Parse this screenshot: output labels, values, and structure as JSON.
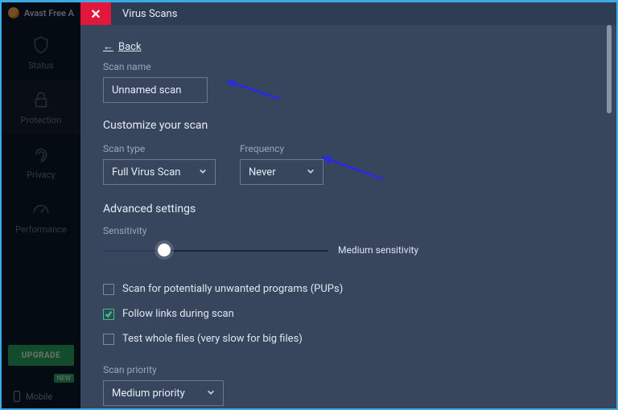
{
  "brand": {
    "name": "Avast Free A"
  },
  "sidebar": {
    "items": [
      {
        "label": "Status"
      },
      {
        "label": "Protection"
      },
      {
        "label": "Privacy"
      },
      {
        "label": "Performance"
      }
    ],
    "upgrade": "UPGRADE",
    "new": "NEW",
    "mobile": "Mobile"
  },
  "topbar": {
    "title": "Virus Scans",
    "close": "✕"
  },
  "page": {
    "back": "Back",
    "scan_name_label": "Scan name",
    "scan_name_value": "Unnamed scan",
    "customize_title": "Customize your scan",
    "scan_type_label": "Scan type",
    "scan_type_value": "Full Virus Scan",
    "frequency_label": "Frequency",
    "frequency_value": "Never",
    "advanced_title": "Advanced settings",
    "sensitivity_label": "Sensitivity",
    "sensitivity_value": "Medium sensitivity",
    "checks": [
      {
        "label": "Scan for potentially unwanted programs (PUPs)",
        "checked": false
      },
      {
        "label": "Follow links during scan",
        "checked": true
      },
      {
        "label": "Test whole files (very slow for big files)",
        "checked": false
      }
    ],
    "priority_label": "Scan priority",
    "priority_value": "Medium priority"
  }
}
